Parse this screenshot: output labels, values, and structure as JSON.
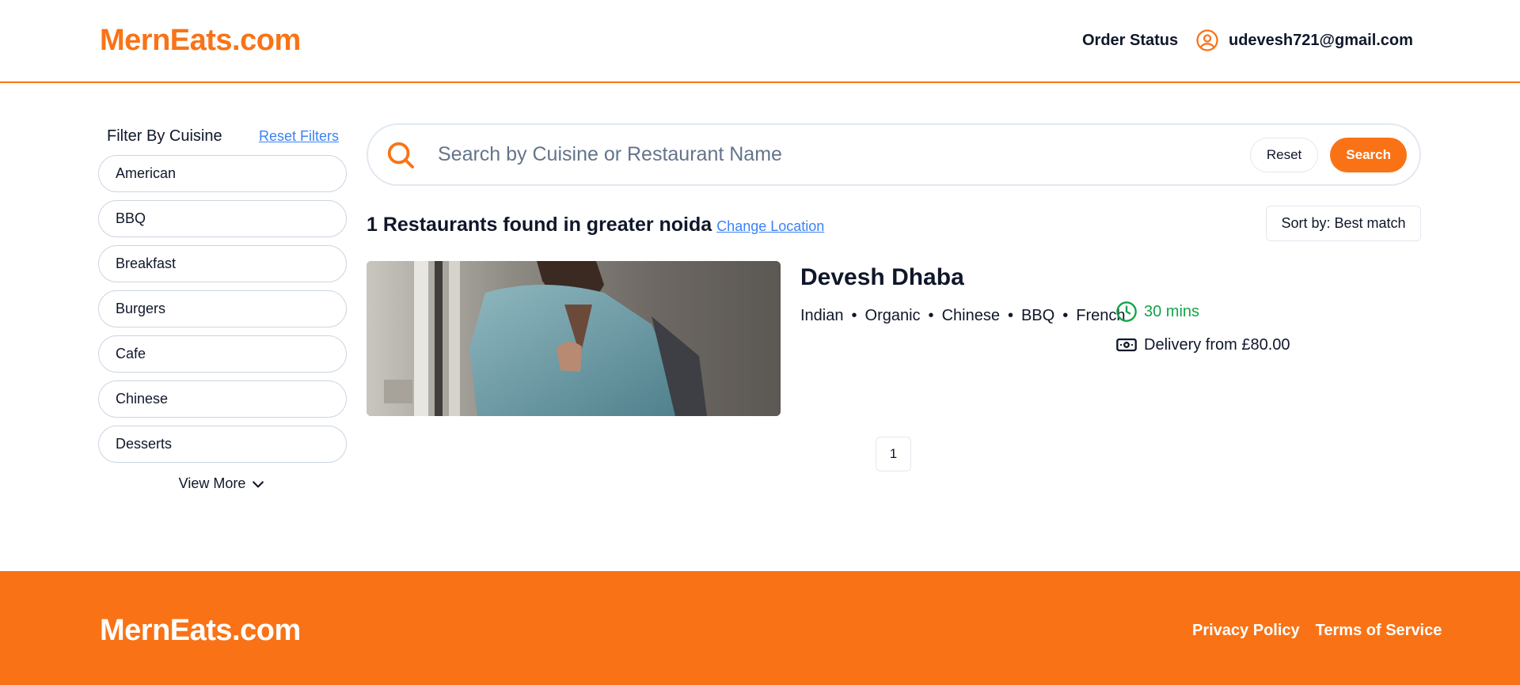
{
  "header": {
    "logo": "MernEats.com",
    "order_status": "Order Status",
    "user_email": "udevesh721@gmail.com"
  },
  "sidebar": {
    "title": "Filter By Cuisine",
    "reset_filters": "Reset Filters",
    "cuisines": [
      "American",
      "BBQ",
      "Breakfast",
      "Burgers",
      "Cafe",
      "Chinese",
      "Desserts"
    ],
    "view_more": "View More"
  },
  "search": {
    "placeholder": "Search by Cuisine or Restaurant Name",
    "reset_label": "Reset",
    "search_label": "Search"
  },
  "results": {
    "count_text": "1 Restaurants found in greater noida",
    "change_location": "Change Location",
    "sort_label": "Sort by: Best match"
  },
  "restaurant": {
    "name": "Devesh Dhaba",
    "cuisines": [
      "Indian",
      "Organic",
      "Chinese",
      "BBQ",
      "French"
    ],
    "delivery_time": "30 mins",
    "delivery_price": "Delivery from £80.00"
  },
  "pagination": {
    "current": "1"
  },
  "footer": {
    "logo": "MernEats.com",
    "privacy": "Privacy Policy",
    "terms": "Terms of Service"
  },
  "colors": {
    "brand": "#f97316",
    "link": "#3b82f6",
    "success": "#16a34a"
  },
  "icons": {
    "search": "search-icon",
    "user": "user-circle-icon",
    "clock": "clock-icon",
    "money": "banknote-icon",
    "chevron": "chevron-down-icon"
  }
}
